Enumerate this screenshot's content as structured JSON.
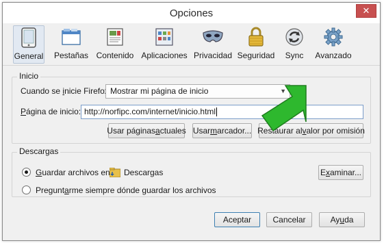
{
  "window": {
    "title": "Opciones"
  },
  "tabs": [
    {
      "label": "General",
      "icon": "general-icon"
    },
    {
      "label": "Pestañas",
      "icon": "tabs-icon"
    },
    {
      "label": "Contenido",
      "icon": "content-icon"
    },
    {
      "label": "Aplicaciones",
      "icon": "applications-icon"
    },
    {
      "label": "Privacidad",
      "icon": "privacy-mask-icon"
    },
    {
      "label": "Seguridad",
      "icon": "lock-icon"
    },
    {
      "label": "Sync",
      "icon": "sync-icon"
    },
    {
      "label": "Avanzado",
      "icon": "gear-icon"
    }
  ],
  "inicio": {
    "title": "Inicio",
    "when_label_pre": "Cuando se ",
    "when_label_u": "i",
    "when_label_post": "nicie Firefox:",
    "when_value": "Mostrar mi página de inicio",
    "home_label_u": "P",
    "home_label_post": "ágina de inicio:",
    "home_value": "http://norfipc.com/internet/inicio.html",
    "btn_current_pre": "Usar páginas ",
    "btn_current_u": "a",
    "btn_current_post": "ctuales",
    "btn_bookmark_pre": "Usar ",
    "btn_bookmark_u": "m",
    "btn_bookmark_post": "arcador...",
    "btn_restore_pre": "Restaurar al ",
    "btn_restore_u": "v",
    "btn_restore_post": "alor por omisión"
  },
  "descargas": {
    "title": "Descargas",
    "save_label_u": "G",
    "save_label_post": "uardar archivos en",
    "folder_value": "Descargas",
    "browse_pre": "E",
    "browse_u": "x",
    "browse_post": "aminar...",
    "ask_label_pre": "Pregunt",
    "ask_label_u": "a",
    "ask_label_post": "rme siempre dónde guardar los archivos"
  },
  "footer": {
    "accept": "Aceptar",
    "cancel": "Cancelar",
    "help_pre": "Ay",
    "help_u": "u",
    "help_post": "da"
  },
  "colors": {
    "arrow": "#2eb82e",
    "selected_tab": "#e2e9f2",
    "close": "#c75050"
  }
}
